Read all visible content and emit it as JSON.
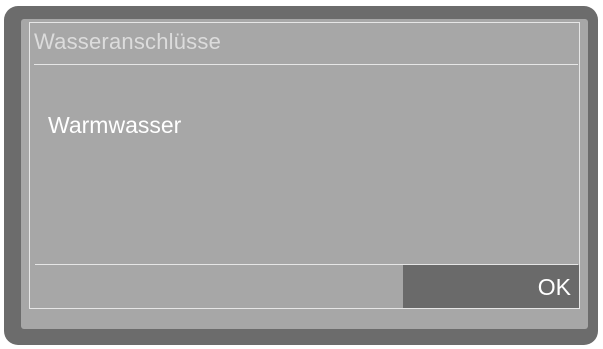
{
  "dialog": {
    "title": "Wasseranschlüsse",
    "message": "Warmwasser",
    "ok_label": "OK"
  },
  "colors": {
    "bezel": "#6c6c6c",
    "screen": "#a7a7a7",
    "ok_button": "#6a6a6a",
    "text": "#ffffff",
    "title_text": "#dcdcdc"
  }
}
